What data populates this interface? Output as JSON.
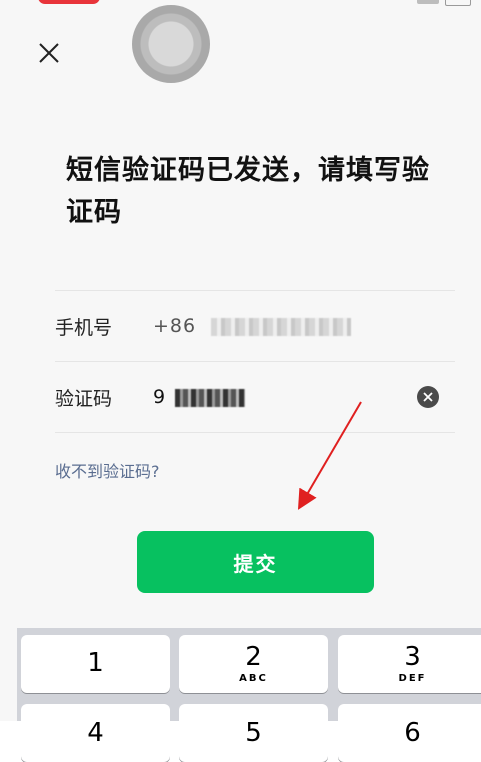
{
  "header": {
    "close_icon": "close-icon"
  },
  "title": "短信验证码已发送，请填写验证码",
  "form": {
    "phone_label": "手机号",
    "phone_prefix": "+86",
    "code_label": "验证码",
    "code_prefix": "9"
  },
  "link": {
    "no_code": "收不到验证码?"
  },
  "submit": {
    "label": "提交"
  },
  "keyboard": {
    "keys": [
      {
        "num": "1",
        "letters": ""
      },
      {
        "num": "2",
        "letters": "ABC"
      },
      {
        "num": "3",
        "letters": "DEF"
      },
      {
        "num": "4",
        "letters": ""
      },
      {
        "num": "5",
        "letters": ""
      },
      {
        "num": "6",
        "letters": ""
      }
    ]
  },
  "colors": {
    "accent": "#07c160",
    "link": "#5a6d90",
    "arrow": "#e02020"
  }
}
